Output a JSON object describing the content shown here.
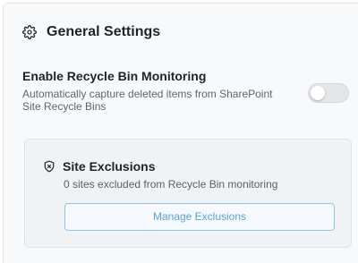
{
  "general": {
    "title": "General Settings",
    "icon": "gear-icon"
  },
  "recycle_bin": {
    "label": "Enable Recycle Bin Monitoring",
    "description": "Automatically capture deleted items from SharePoint Site Recycle Bins",
    "toggle_on": false
  },
  "exclusions": {
    "icon": "shield-x-icon",
    "title": "Site Exclusions",
    "summary": "0 sites excluded from Recycle Bin monitoring",
    "button_label": "Manage Exclusions"
  },
  "colors": {
    "accent": "#5aa2dc",
    "accent_border": "#8cc3ec",
    "toggle_off": "#e4e6e9"
  }
}
